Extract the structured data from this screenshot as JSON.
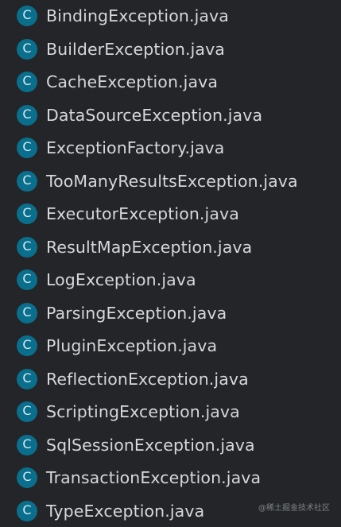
{
  "icon": {
    "letter": "C",
    "name": "class-icon",
    "color": "#0a6f8c"
  },
  "files": [
    "BindingException.java",
    "BuilderException.java",
    "CacheException.java",
    "DataSourceException.java",
    "ExceptionFactory.java",
    "TooManyResultsException.java",
    "ExecutorException.java",
    "ResultMapException.java",
    "LogException.java",
    "ParsingException.java",
    "PluginException.java",
    "ReflectionException.java",
    "ScriptingException.java",
    "SqlSessionException.java",
    "TransactionException.java",
    "TypeException.java"
  ],
  "watermark": "@稀土掘金技术社区"
}
